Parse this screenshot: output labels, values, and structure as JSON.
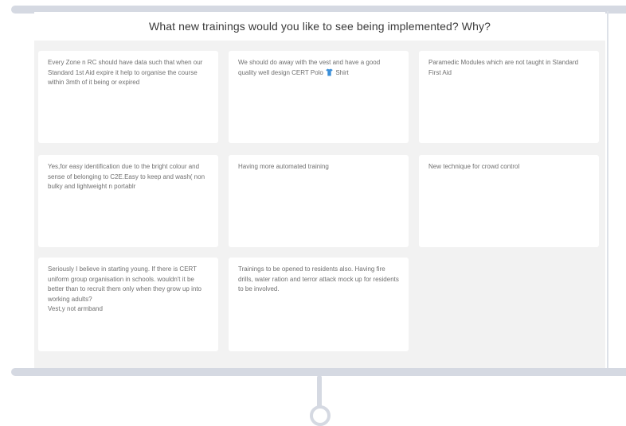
{
  "board": {
    "title": "What new trainings would you like to see being implemented? Why?",
    "cards": [
      {
        "text": "Every Zone n RC should have data such that when our Standard 1st Aid expire it help to organise the course within 3mth of it being or expired"
      },
      {
        "text_before_icon": "We should do away with the vest and have a good quality well design CERT Polo ",
        "icon": "shirt-icon",
        "text_after_icon": " Shirt"
      },
      {
        "text": "Paramedic Modules which are not taught in Standard First Aid"
      },
      {
        "text": "Yes,for easy identification due to the bright colour and sense of belonging to C2E.Easy to keep and wash( non bulky and lightweight n portablr"
      },
      {
        "text": "Having more automated training"
      },
      {
        "text": "New technique for crowd control"
      },
      {
        "line1": "Seriously I believe in starting young. If there is CERT uniform group organisation in schools. wouldn't it be better than to recruit them only when they grow up into working adults?",
        "line2": "Vest,y not armband"
      },
      {
        "text": "Trainings to be opened to residents also. Having fire drills, water ration and terror attack mock up for residents to be involved."
      }
    ]
  },
  "colors": {
    "rail": "#d5d9e2",
    "board_bg": "#f2f2f2",
    "card_bg": "#ffffff",
    "card_text": "#707070",
    "title_text": "#3a3a3a",
    "icon_blue": "#3b8fd9"
  }
}
